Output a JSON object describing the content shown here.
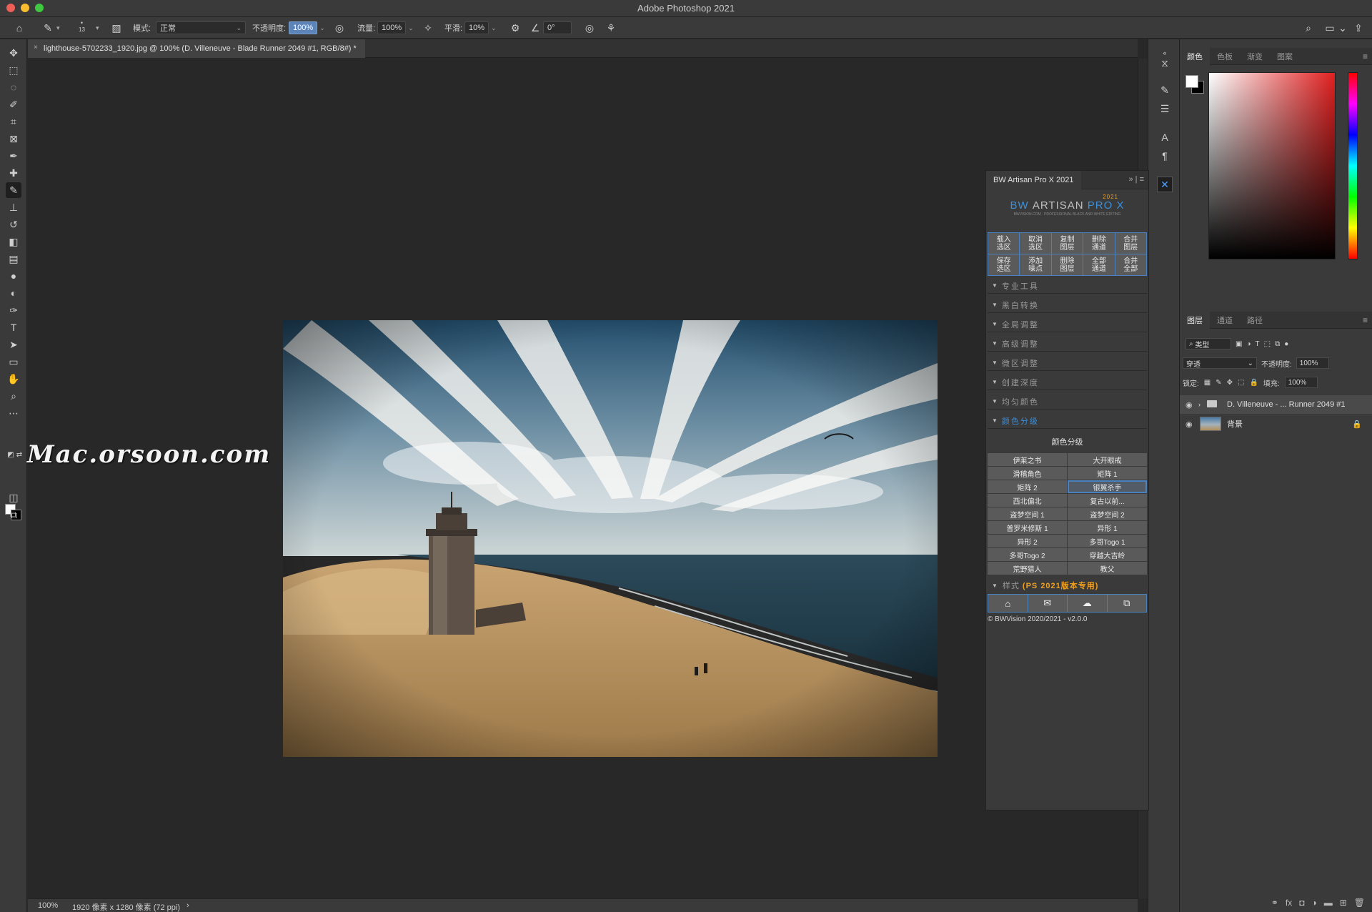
{
  "app": {
    "title": "Adobe Photoshop 2021"
  },
  "options_bar": {
    "brush_size": "13",
    "mode_label": "模式:",
    "mode_value": "正常",
    "opacity_label": "不透明度:",
    "opacity_value": "100%",
    "flow_label": "流量:",
    "flow_value": "100%",
    "smoothing_label": "平滑:",
    "smoothing_value": "10%",
    "angle_value": "0°"
  },
  "document": {
    "tab_title": "lighthouse-5702233_1920.jpg @ 100% (D. Villeneuve - Blade Runner 2049 #1, RGB/8#) *",
    "close": "×"
  },
  "watermark": "Mac.orsoon.com",
  "status_bar": {
    "zoom": "100%",
    "info": "1920 像素 x 1280 像素 (72 ppi)",
    "arrow": "›"
  },
  "color_panel": {
    "tabs": [
      "颜色",
      "色板",
      "渐变",
      "图案"
    ],
    "fg_color": "#ffffff",
    "bg_color": "#000000",
    "hue_color": "#e02020"
  },
  "layers_panel": {
    "tabs": [
      "图层",
      "通道",
      "路径"
    ],
    "filter_label": "类型",
    "blend_mode": "穿透",
    "opacity_label": "不透明度:",
    "opacity_value": "100%",
    "lock_label": "锁定:",
    "fill_label": "填充:",
    "fill_value": "100%",
    "layers": [
      {
        "name": "D. Villeneuve - ... Runner 2049 #1",
        "type": "group",
        "selected": true
      },
      {
        "name": "背景",
        "type": "image",
        "locked": true
      }
    ]
  },
  "bw_panel": {
    "title": "BW Artisan Pro X 2021",
    "logo_prefix": "BW",
    "logo_main": "ARTISAN",
    "logo_suffix": "PRO X",
    "logo_year": "2021",
    "logo_sub": "BWVISION.COM · PROFESSIONAL BLACK AND WHITE EDITING",
    "buttons": [
      "载入\n选区",
      "取消\n选区",
      "复制\n图层",
      "删除\n通道",
      "合并\n图层",
      "保存\n选区",
      "添加\n噪点",
      "删除\n图层",
      "全部\n通道",
      "合并\n全部"
    ],
    "sections": [
      "专业工具",
      "黑白转换",
      "全局调整",
      "高级调整",
      "微区调整",
      "创建深度",
      "均匀颜色",
      "颜色分级"
    ],
    "grading_title": "颜色分级",
    "grading_items": [
      "伊莱之书",
      "大开眼戒",
      "滑稽角色",
      "矩阵 1",
      "矩阵 2",
      "银翼杀手",
      "西北偏北",
      "复古以前...",
      "盗梦空间 1",
      "盗梦空间 2",
      "普罗米修斯 1",
      "异形 1",
      "异形 2",
      "多哥Togo 1",
      "多哥Togo 2",
      "穿越大吉岭",
      "荒野猎人",
      "教父"
    ],
    "selected_item": "银翼杀手",
    "style_label": "样式",
    "style_note": "(PS 2021版本专用)",
    "footer": "© BWVision 2020/2021 - v2.0.0"
  }
}
